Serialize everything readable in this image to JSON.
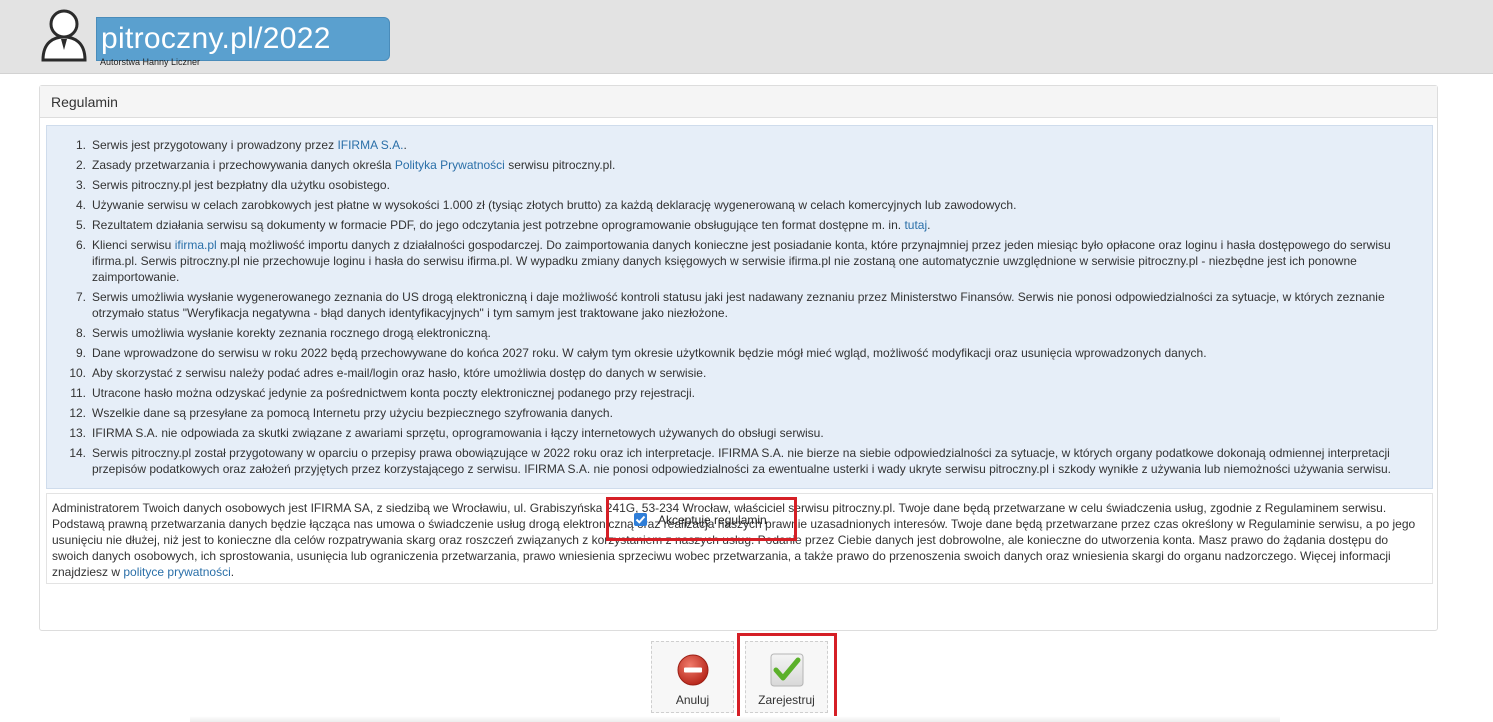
{
  "header": {
    "logo_text": "pitroczny.pl/2022",
    "logo_subtitle": "Autorstwa Hanny Liczner"
  },
  "panel": {
    "title": "Regulamin"
  },
  "rules": [
    {
      "num": "1.",
      "parts": [
        {
          "t": "Serwis jest przygotowany i prowadzony przez "
        },
        {
          "t": "IFIRMA S.A.",
          "link": true
        },
        {
          "t": "."
        }
      ]
    },
    {
      "num": "2.",
      "parts": [
        {
          "t": "Zasady przetwarzania i przechowywania danych określa "
        },
        {
          "t": "Polityka Prywatności",
          "link": true
        },
        {
          "t": " serwisu pitroczny.pl."
        }
      ]
    },
    {
      "num": "3.",
      "parts": [
        {
          "t": "Serwis pitroczny.pl jest bezpłatny dla użytku osobistego."
        }
      ]
    },
    {
      "num": "4.",
      "parts": [
        {
          "t": "Używanie serwisu w celach zarobkowych jest płatne w wysokości 1.000 zł (tysiąc złotych brutto) za każdą deklarację wygenerowaną w celach komercyjnych lub zawodowych."
        }
      ]
    },
    {
      "num": "5.",
      "parts": [
        {
          "t": "Rezultatem działania serwisu są dokumenty w formacie PDF, do jego odczytania jest potrzebne oprogramowanie obsługujące ten format dostępne m. in. "
        },
        {
          "t": "tutaj",
          "link": true
        },
        {
          "t": "."
        }
      ]
    },
    {
      "num": "6.",
      "parts": [
        {
          "t": "Klienci serwisu "
        },
        {
          "t": "ifirma.pl",
          "link": true
        },
        {
          "t": " mają możliwość importu danych z działalności gospodarczej. Do zaimportowania danych konieczne jest posiadanie konta, które przynajmniej przez jeden miesiąc było opłacone oraz loginu i hasła dostępowego do serwisu ifirma.pl. Serwis pitroczny.pl nie przechowuje loginu i hasła do serwisu ifirma.pl. W wypadku zmiany danych księgowych w serwisie ifirma.pl nie zostaną one automatycznie uwzględnione w serwisie pitroczny.pl - niezbędne jest ich ponowne zaimportowanie."
        }
      ]
    },
    {
      "num": "7.",
      "parts": [
        {
          "t": "Serwis umożliwia wysłanie wygenerowanego zeznania do US drogą elektroniczną i daje możliwość kontroli statusu jaki jest nadawany zeznaniu przez Ministerstwo Finansów. Serwis nie ponosi odpowiedzialności za sytuacje, w których zeznanie otrzymało status \"Weryfikacja negatywna - błąd danych identyfikacyjnych\" i tym samym jest traktowane jako niezłożone."
        }
      ]
    },
    {
      "num": "8.",
      "parts": [
        {
          "t": "Serwis umożliwia wysłanie korekty zeznania rocznego drogą elektroniczną."
        }
      ]
    },
    {
      "num": "9.",
      "parts": [
        {
          "t": "Dane wprowadzone do serwisu w roku 2022 będą przechowywane do końca 2027 roku. W całym tym okresie użytkownik będzie mógł mieć wgląd, możliwość modyfikacji oraz usunięcia wprowadzonych danych."
        }
      ]
    },
    {
      "num": "10.",
      "parts": [
        {
          "t": "Aby skorzystać z serwisu należy podać adres e-mail/login oraz hasło, które umożliwia dostęp do danych w serwisie."
        }
      ]
    },
    {
      "num": "11.",
      "parts": [
        {
          "t": "Utracone hasło można odzyskać jedynie za pośrednictwem konta poczty elektronicznej podanego przy rejestracji."
        }
      ]
    },
    {
      "num": "12.",
      "parts": [
        {
          "t": "Wszelkie dane są przesyłane za pomocą Internetu przy użyciu bezpiecznego szyfrowania danych."
        }
      ]
    },
    {
      "num": "13.",
      "parts": [
        {
          "t": "IFIRMA S.A. nie odpowiada za skutki związane z awariami sprzętu, oprogramowania i łączy internetowych używanych do obsługi serwisu."
        }
      ]
    },
    {
      "num": "14.",
      "parts": [
        {
          "t": "Serwis pitroczny.pl został przygotowany w oparciu o przepisy prawa obowiązujące w 2022 roku oraz ich interpretacje. IFIRMA S.A. nie bierze na siebie odpowiedzialności za sytuacje, w których organy podatkowe dokonają odmiennej interpretacji przepisów podatkowych oraz założeń przyjętych przez korzystającego z serwisu. IFIRMA S.A. nie ponosi odpowiedzialności za ewentualne usterki i wady ukryte serwisu pitroczny.pl i szkody wynikłe z używania lub niemożności używania serwisu."
        }
      ]
    }
  ],
  "admin": {
    "text": "Administratorem Twoich danych osobowych jest IFIRMA SA, z siedzibą we Wrocławiu, ul. Grabiszyńska 241G, 53-234 Wrocław, właściciel serwisu pitroczny.pl. Twoje dane będą przetwarzane w celu świadczenia usług, zgodnie z Regulaminem serwisu. Podstawą prawną przetwarzania danych będzie łącząca nas umowa o świadczenie usług drogą elektroniczną oraz realizacja naszych prawnie uzasadnionych interesów. Twoje dane będą przetwarzane przez czas określony w Regulaminie serwisu, a po jego usunięciu nie dłużej, niż jest to konieczne dla celów rozpatrywania skarg oraz roszczeń związanych z korzystaniem z naszych usług. Podanie przez Ciebie danych jest dobrowolne, ale konieczne do utworzenia konta. Masz prawo do żądania dostępu do swoich danych osobowych, ich sprostowania, usunięcia lub ograniczenia przetwarzania, prawo wniesienia sprzeciwu wobec przetwarzania, a także prawo do przenoszenia swoich danych oraz wniesienia skargi do organu nadzorczego. Więcej informacji znajdziesz w ",
    "link_text": "polityce prywatności",
    "suffix": "."
  },
  "accept": {
    "label": "Akceptuję regulamin",
    "checked": true
  },
  "buttons": {
    "cancel_label": "Anuluj",
    "submit_label": "Zarejestruj"
  },
  "colors": {
    "link": "#2a6fa8",
    "highlight": "#d51f26",
    "rules_bg": "#e6eef8"
  }
}
